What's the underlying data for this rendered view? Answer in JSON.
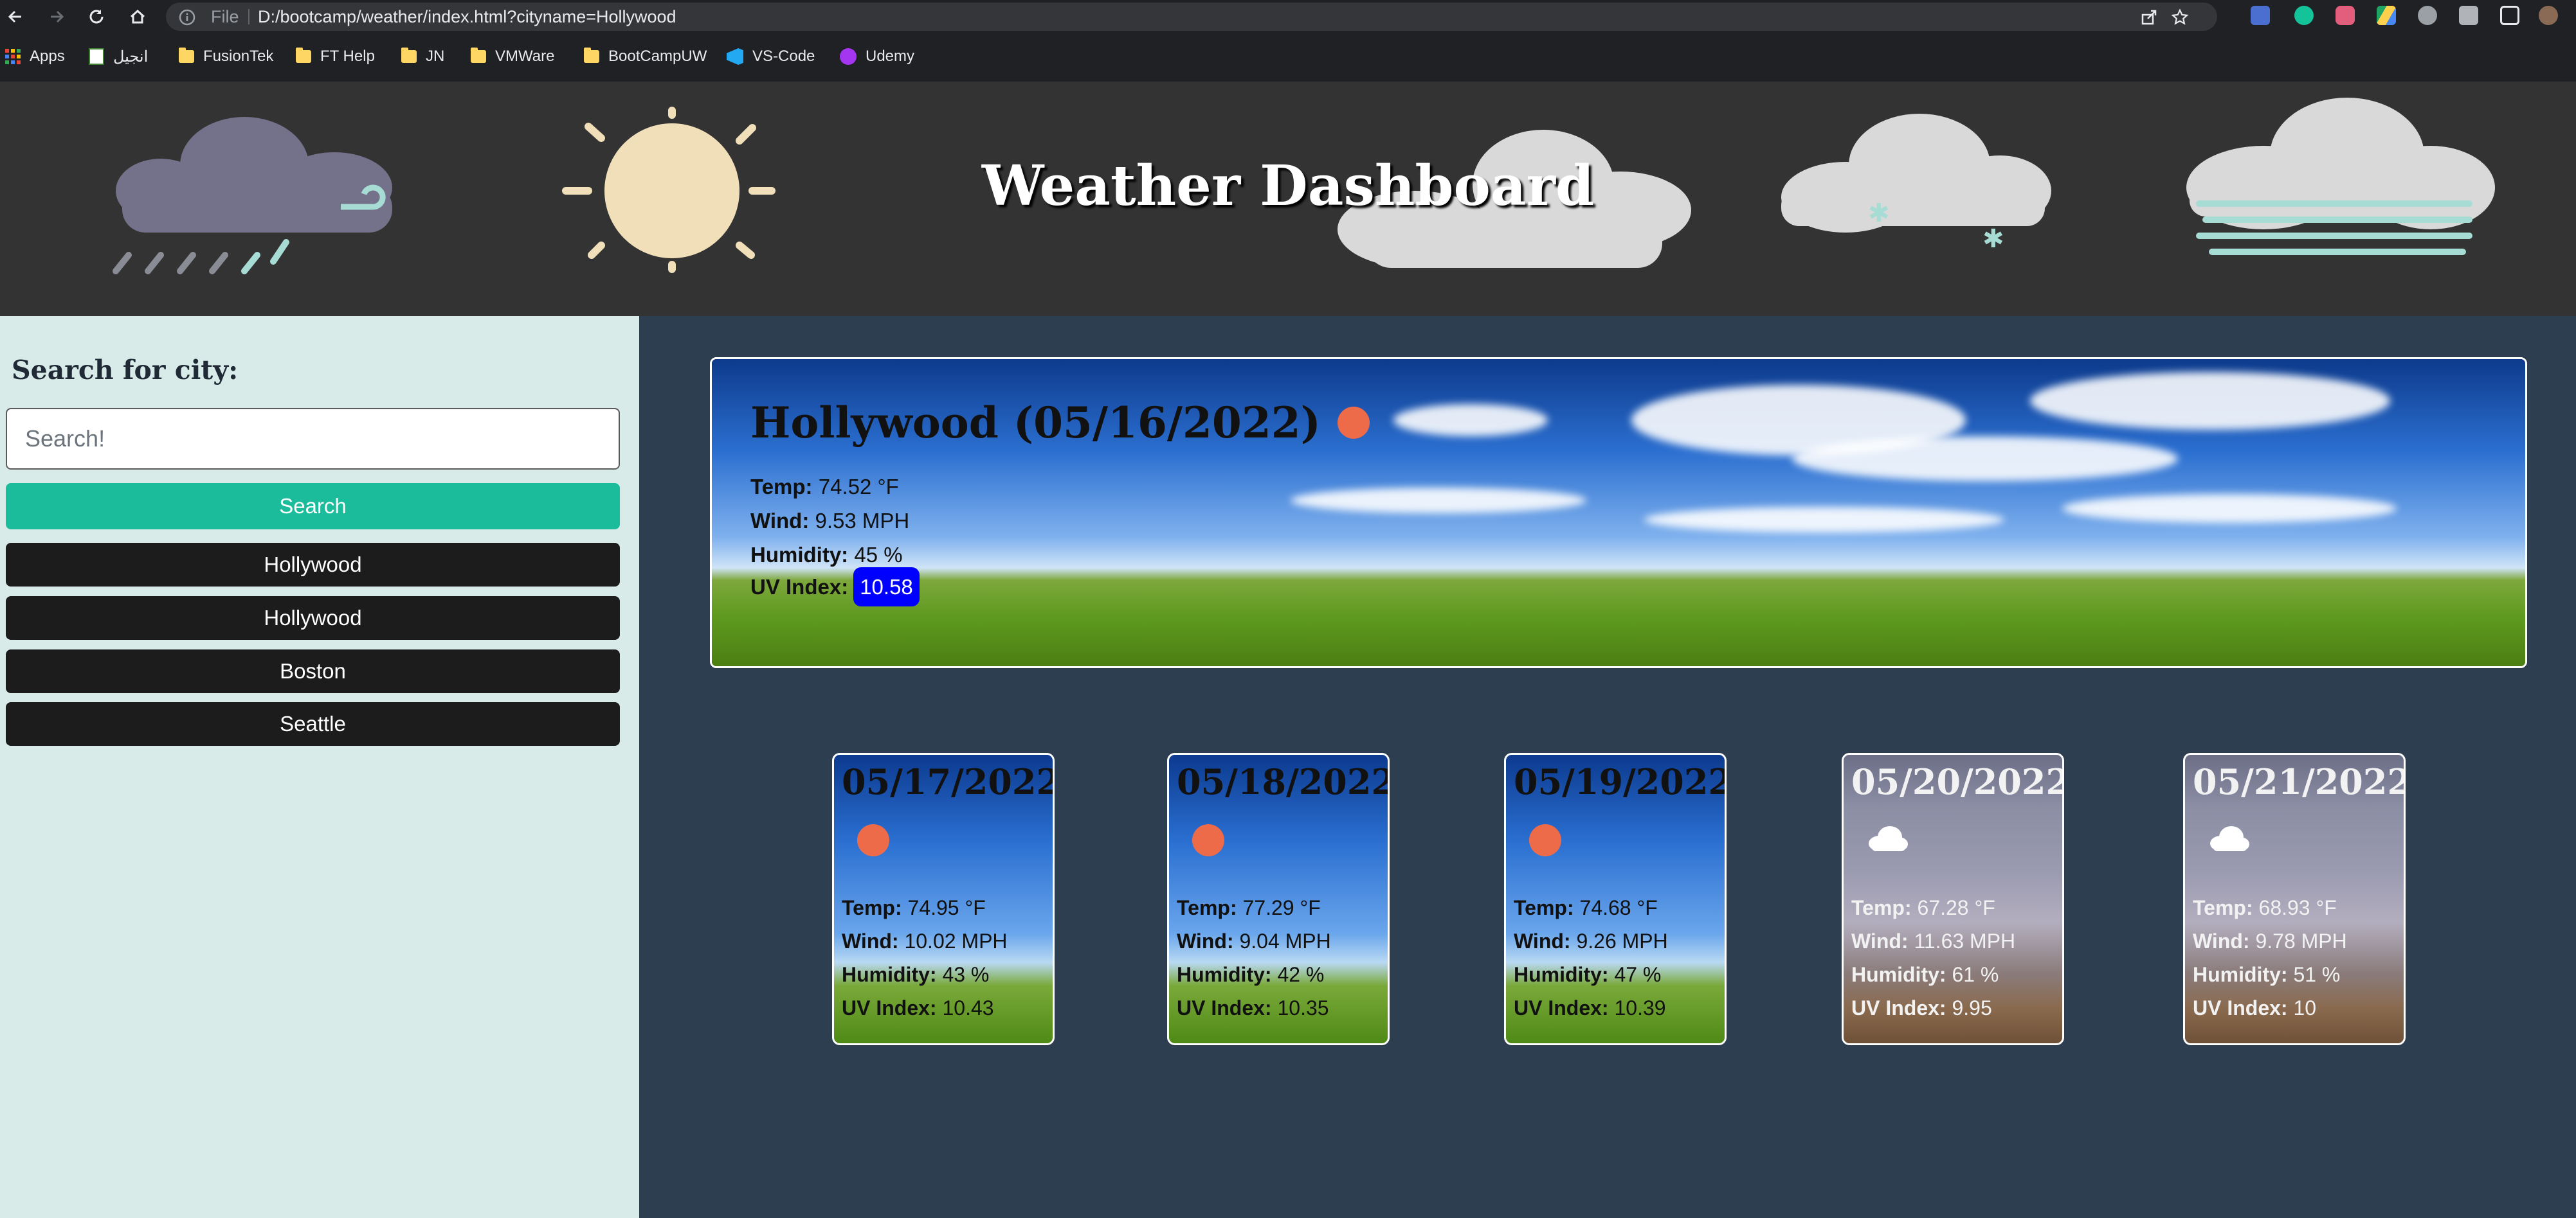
{
  "browser": {
    "file_label": "File",
    "url": "D:/bootcamp/weather/index.html?cityname=Hollywood",
    "bookmarks": [
      "Apps",
      "انجيل",
      "FusionTek",
      "FT Help",
      "JN",
      "VMWare",
      "BootCampUW",
      "VS-Code",
      "Udemy"
    ]
  },
  "header": {
    "title": "Weather Dashboard"
  },
  "sidebar": {
    "heading": "Search for city:",
    "search_placeholder": "Search!",
    "search_button": "Search",
    "history": [
      "Hollywood",
      "Hollywood",
      "Boston",
      "Seattle"
    ]
  },
  "current": {
    "city_date": "Hollywood (05/16/2022)",
    "icon": "sun-icon",
    "temp_label": "Temp:",
    "temp": "74.52 °F",
    "wind_label": "Wind:",
    "wind": "9.53 MPH",
    "humidity_label": "Humidity:",
    "humidity": "45 %",
    "uv_label": "UV Index:",
    "uv": "10.58",
    "uv_color": "#0000ff"
  },
  "forecast": [
    {
      "date": "05/17/2022",
      "icon": "sun-icon",
      "background": "sunny",
      "temp_label": "Temp:",
      "temp": "74.95 °F",
      "wind_label": "Wind:",
      "wind": "10.02 MPH",
      "humidity_label": "Humidity:",
      "humidity": "43 %",
      "uv_label": "UV Index:",
      "uv": "10.43"
    },
    {
      "date": "05/18/2022",
      "icon": "sun-icon",
      "background": "sunny",
      "temp_label": "Temp:",
      "temp": "77.29 °F",
      "wind_label": "Wind:",
      "wind": "9.04 MPH",
      "humidity_label": "Humidity:",
      "humidity": "42 %",
      "uv_label": "UV Index:",
      "uv": "10.35"
    },
    {
      "date": "05/19/2022",
      "icon": "sun-icon",
      "background": "sunny",
      "temp_label": "Temp:",
      "temp": "74.68 °F",
      "wind_label": "Wind:",
      "wind": "9.26 MPH",
      "humidity_label": "Humidity:",
      "humidity": "47 %",
      "uv_label": "UV Index:",
      "uv": "10.39"
    },
    {
      "date": "05/20/2022",
      "icon": "cloud-icon",
      "background": "cloudy",
      "temp_label": "Temp:",
      "temp": "67.28 °F",
      "wind_label": "Wind:",
      "wind": "11.63 MPH",
      "humidity_label": "Humidity:",
      "humidity": "61 %",
      "uv_label": "UV Index:",
      "uv": "9.95"
    },
    {
      "date": "05/21/2022",
      "icon": "cloud-icon",
      "background": "cloudy",
      "temp_label": "Temp:",
      "temp": "68.93 °F",
      "wind_label": "Wind:",
      "wind": "9.78 MPH",
      "humidity_label": "Humidity:",
      "humidity": "51 %",
      "uv_label": "UV Index:",
      "uv": "10"
    }
  ],
  "colors": {
    "sun": "#ee6b4a",
    "search_button": "#1abc9c",
    "history_button": "#1c1c1c",
    "sidebar_bg": "#d9ebe8",
    "main_bg": "#2c3e50",
    "header_bg": "#333333"
  }
}
